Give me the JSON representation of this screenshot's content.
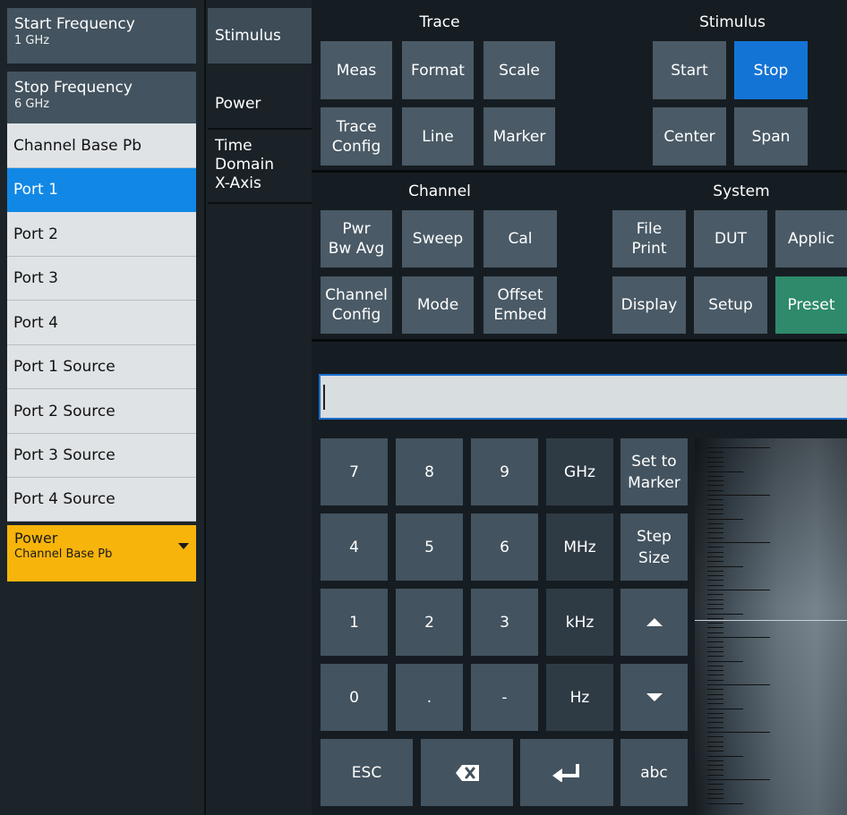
{
  "left_panel": {
    "start_frequency": {
      "label": "Start Frequency",
      "value": "1 GHz"
    },
    "stop_frequency": {
      "label": "Stop Frequency",
      "value": "6 GHz"
    },
    "items": [
      "Channel Base Pb",
      "Port 1",
      "Port 2",
      "Port 3",
      "Port 4",
      "Port 1 Source",
      "Port 2 Source",
      "Port 3 Source",
      "Port 4 Source"
    ],
    "selected_item": "Port 1",
    "power_dropdown": {
      "label": "Power",
      "value": "Channel Base Pb"
    }
  },
  "tabs": [
    {
      "label": "Stimulus",
      "active": true
    },
    {
      "label": "Power",
      "active": false
    },
    {
      "label": "Time\nDomain\nX-Axis",
      "active": false
    }
  ],
  "sections": {
    "trace": "Trace",
    "stimulus": "Stimulus",
    "channel": "Channel",
    "system": "System"
  },
  "trace_keys": [
    "Meas",
    "Format",
    "Scale",
    "Trace\nConfig",
    "Line",
    "Marker"
  ],
  "stimulus_keys": [
    "Start",
    "Stop",
    "Center",
    "Span"
  ],
  "channel_keys": [
    "Pwr\nBw Avg",
    "Sweep",
    "Cal",
    "Channel\nConfig",
    "Mode",
    "Offset\nEmbed"
  ],
  "system_keys": [
    "File\nPrint",
    "DUT",
    "Applic",
    "Display",
    "Setup",
    "Preset"
  ],
  "entry_field": {
    "value": ""
  },
  "keypad": {
    "digits": [
      "7",
      "8",
      "9",
      "4",
      "5",
      "6",
      "1",
      "2",
      "3",
      "0",
      ".",
      "-"
    ],
    "units": [
      "GHz",
      "MHz",
      "kHz",
      "Hz"
    ],
    "set_to_marker": "Set to\nMarker",
    "step_size": "Step\nSize",
    "esc": "ESC",
    "abc": "abc",
    "icons": [
      "up-arrow",
      "down-arrow",
      "backspace",
      "enter"
    ]
  },
  "colors": {
    "selected_blue": "#1188e6",
    "active_key_blue": "#1474d6",
    "preset_green": "#2e8a6b",
    "dropdown_yellow": "#f7b40b"
  }
}
